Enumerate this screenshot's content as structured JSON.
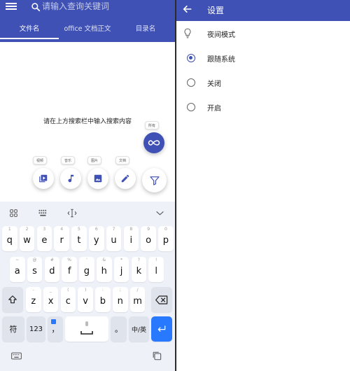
{
  "search": {
    "placeholder": "请输入查询关键词"
  },
  "tabs": [
    {
      "label": "文件名"
    },
    {
      "label": "office 文档正文"
    },
    {
      "label": "目录名"
    }
  ],
  "hint": "请在上方搜索栏中输入搜索内容",
  "fab_chips": {
    "all": "所有",
    "video": "视频",
    "music": "音乐",
    "image": "图片",
    "doc": "文档"
  },
  "keyboard": {
    "row1": [
      {
        "alt": "1",
        "key": "q"
      },
      {
        "alt": "2",
        "key": "w"
      },
      {
        "alt": "3",
        "key": "e"
      },
      {
        "alt": "4",
        "key": "r"
      },
      {
        "alt": "5",
        "key": "t"
      },
      {
        "alt": "6",
        "key": "y"
      },
      {
        "alt": "7",
        "key": "u"
      },
      {
        "alt": "8",
        "key": "i"
      },
      {
        "alt": "9",
        "key": "o"
      },
      {
        "alt": "0",
        "key": "p"
      }
    ],
    "row2": [
      {
        "alt": "~",
        "key": "a"
      },
      {
        "alt": "@",
        "key": "s"
      },
      {
        "alt": "#",
        "key": "d"
      },
      {
        "alt": "%",
        "key": "f"
      },
      {
        "alt": "'",
        "key": "g"
      },
      {
        "alt": "&",
        "key": "h"
      },
      {
        "alt": "*",
        "key": "j"
      },
      {
        "alt": "?",
        "key": "k"
      },
      {
        "alt": "!",
        "key": "l"
      }
    ],
    "row3": [
      {
        "alt": "-",
        "key": "z"
      },
      {
        "alt": "_",
        "key": "x"
      },
      {
        "alt": "(",
        "key": "c"
      },
      {
        "alt": ")",
        "key": "v"
      },
      {
        "alt": ":",
        "key": "b"
      },
      {
        "alt": ";",
        "key": "n"
      },
      {
        "alt": "/",
        "key": "m"
      }
    ],
    "symbol_key": "符",
    "num_key": "123",
    "comma_key": "，",
    "period_key": "。",
    "lang_key": "中/英"
  },
  "settings": {
    "title": "设置",
    "section_label": "夜间模式",
    "options": [
      {
        "label": "跟随系统",
        "selected": true
      },
      {
        "label": "关闭",
        "selected": false
      },
      {
        "label": "开启",
        "selected": false
      }
    ]
  },
  "colors": {
    "primary": "#3f51b5",
    "keyboard_bg": "#eef1f8",
    "enter_key": "#2979ff"
  }
}
